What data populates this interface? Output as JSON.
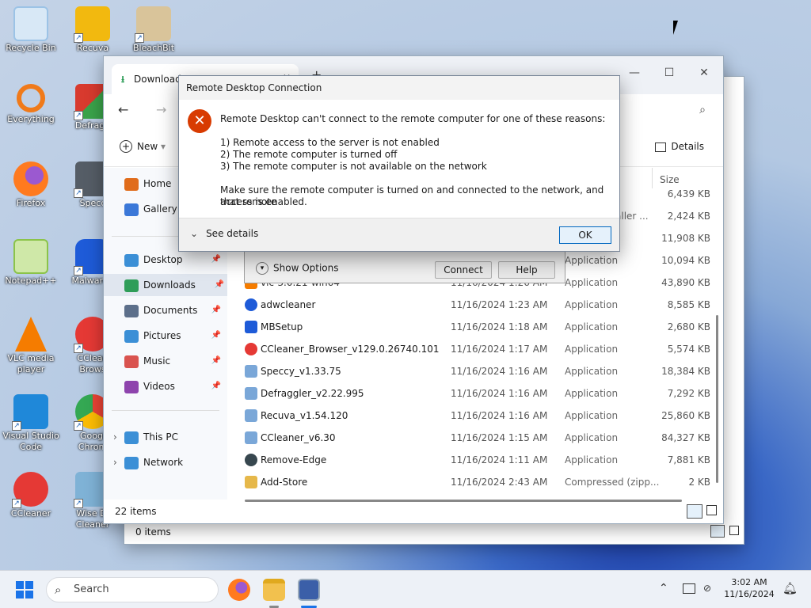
{
  "desktop": {
    "icons": [
      {
        "label": "Recycle Bin",
        "icon": "recycle-bin-icon",
        "color": "#cfe4f7"
      },
      {
        "label": "Recuva",
        "icon": "recuva-icon",
        "color": "#f2b90f"
      },
      {
        "label": "BleachBit",
        "icon": "bleachbit-icon",
        "color": "#d9c49a"
      },
      {
        "label": "Everything",
        "icon": "everything-search-icon",
        "color": "#f07a1a"
      },
      {
        "label": "Defraggler",
        "icon": "defraggler-icon",
        "color": "#d83a2e"
      },
      {
        "label": "Firefox",
        "icon": "firefox-icon",
        "color": "#ff7a1f"
      },
      {
        "label": "Speccy",
        "icon": "speccy-icon",
        "color": "#555d66"
      },
      {
        "label": "Notepad++",
        "icon": "notepadpp-icon",
        "color": "#8bc34a"
      },
      {
        "label": "Malwareb...",
        "icon": "malwarebytes-icon",
        "color": "#1e5bd8"
      },
      {
        "label": "VLC media player",
        "icon": "vlc-icon",
        "color": "#f57c00"
      },
      {
        "label": "CCleaner Browser",
        "icon": "ccleaner-browser-icon",
        "color": "#e53935"
      },
      {
        "label": "Visual Studio Code",
        "icon": "vscode-icon",
        "color": "#1f88d9"
      },
      {
        "label": "Google Chrome",
        "icon": "chrome-icon",
        "color": "#34a853"
      },
      {
        "label": "CCleaner",
        "icon": "ccleaner-icon",
        "color": "#e53935"
      },
      {
        "label": "Wise Disk Cleaner",
        "icon": "wise-disk-cleaner-icon",
        "color": "#7fb2d6"
      }
    ]
  },
  "explorer": {
    "tab_title": "Downloads",
    "close_tab": "✕",
    "new_tab": "+",
    "new_label": "New",
    "details_label": "Details",
    "size_header": "Size",
    "sidebar": [
      {
        "label": "Home",
        "color": "#e06c1b"
      },
      {
        "label": "Gallery",
        "color": "#3b78d8"
      },
      {
        "label": "Desktop",
        "color": "#3b8fd6"
      },
      {
        "label": "Downloads",
        "color": "#2e9d58"
      },
      {
        "label": "Documents",
        "color": "#5c6f8a"
      },
      {
        "label": "Pictures",
        "color": "#3b8fd6"
      },
      {
        "label": "Music",
        "color": "#d9534f"
      },
      {
        "label": "Videos",
        "color": "#8e44ad"
      },
      {
        "label": "This PC",
        "color": "#3b8fd6"
      },
      {
        "label": "Network",
        "color": "#3b8fd6"
      }
    ],
    "top_sizes": [
      "6,439 KB",
      "2,424 KB",
      "11,908 KB"
    ],
    "partial_type": "aller ...",
    "partial_name": "vlc-3.0.21-win64",
    "partial_date": "11/16/2024 1:26 AM",
    "files": [
      {
        "name": "",
        "date": "",
        "type": "Application",
        "size": "10,094 KB",
        "color": "#7aa7d8"
      },
      {
        "name": "",
        "date": "",
        "type": "Application",
        "size": "43,890 KB",
        "color": "#f57c00"
      },
      {
        "name": "adwcleaner",
        "date": "11/16/2024 1:23 AM",
        "type": "Application",
        "size": "8,585 KB",
        "color": "#1e5bd8"
      },
      {
        "name": "MBSetup",
        "date": "11/16/2024 1:18 AM",
        "type": "Application",
        "size": "2,680 KB",
        "color": "#1e5bd8"
      },
      {
        "name": "CCleaner_Browser_v129.0.26740.101",
        "date": "11/16/2024 1:17 AM",
        "type": "Application",
        "size": "5,574 KB",
        "color": "#e53935"
      },
      {
        "name": "Speccy_v1.33.75",
        "date": "11/16/2024 1:16 AM",
        "type": "Application",
        "size": "18,384 KB",
        "color": "#7aa7d8"
      },
      {
        "name": "Defraggler_v2.22.995",
        "date": "11/16/2024 1:16 AM",
        "type": "Application",
        "size": "7,292 KB",
        "color": "#7aa7d8"
      },
      {
        "name": "Recuva_v1.54.120",
        "date": "11/16/2024 1:16 AM",
        "type": "Application",
        "size": "25,860 KB",
        "color": "#7aa7d8"
      },
      {
        "name": "CCleaner_v6.30",
        "date": "11/16/2024 1:15 AM",
        "type": "Application",
        "size": "84,327 KB",
        "color": "#7aa7d8"
      },
      {
        "name": "Remove-Edge",
        "date": "11/16/2024 1:11 AM",
        "type": "Application",
        "size": "7,881 KB",
        "color": "#37474f"
      },
      {
        "name": "Add-Store",
        "date": "11/16/2024 2:43 AM",
        "type": "Compressed (zipp...",
        "size": "2 KB",
        "color": "#e6b84a"
      }
    ],
    "item_count": "22 items"
  },
  "explorer_back": {
    "status": "0 items"
  },
  "rdc": {
    "show_options": "Show Options",
    "connect": "Connect",
    "help": "Help"
  },
  "dialog": {
    "title": "Remote Desktop Connection",
    "message": "Remote Desktop can't connect to the remote computer for one of these reasons:",
    "reason1": "1) Remote access to the server is not enabled",
    "reason2": "2) The remote computer is turned off",
    "reason3": "3) The remote computer is not available on the network",
    "advice_line1": "Make sure the remote computer is turned on and connected to the network, and that remote",
    "advice_line2": "access is enabled.",
    "see_details": "See details",
    "ok": "OK",
    "error_color": "#d83b01"
  },
  "taskbar": {
    "search_placeholder": "Search",
    "time": "3:02 AM",
    "date": "11/16/2024"
  }
}
